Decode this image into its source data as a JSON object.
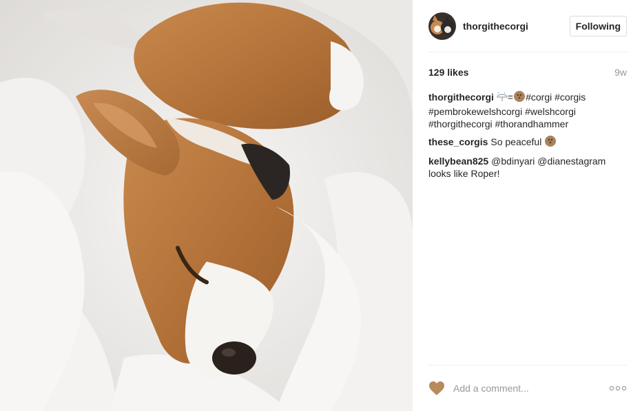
{
  "photo": {
    "icon": "sleeping-corgi-photo"
  },
  "header": {
    "username": "thorgithecorgi",
    "follow_label": "Following"
  },
  "stats": {
    "likes": "129 likes",
    "age": "9w"
  },
  "caption": {
    "user": "thorgithecorgi",
    "text_after_emojis": "#corgi #corgis #pembrokewelshcorgi #welshcorgi #thorgithecorgi #thorandhammer",
    "equals": "="
  },
  "comments": [
    {
      "user": "these_corgis",
      "text": "So peaceful"
    },
    {
      "user": "kellybean825",
      "text": "@bdinyari @dianestagram looks like Roper!"
    }
  ],
  "footer": {
    "placeholder": "Add a comment...",
    "heart_icon": "heart-icon",
    "more_icon": "more-options-icon"
  },
  "colors": {
    "heart": "#b88a5c",
    "border": "#efefef",
    "muted": "#999999"
  }
}
